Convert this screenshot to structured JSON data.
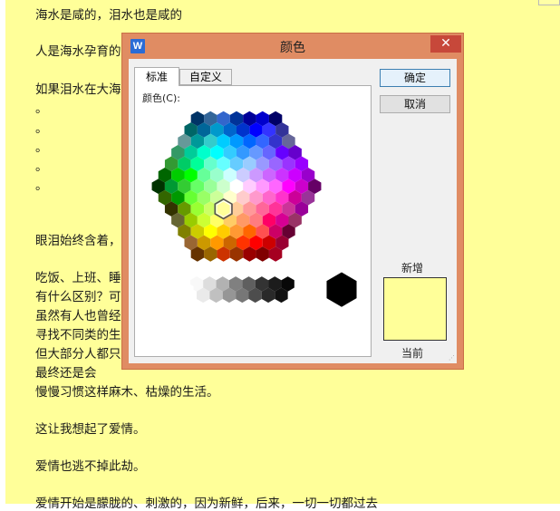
{
  "document": {
    "lines": [
      "海水是咸的，泪水也是咸的",
      "人是海水孕育的",
      "如果泪水在大海里",
      "。",
      "。",
      "。",
      "。",
      "。",
      "眼泪始终含着，",
      "吃饭、上班、睡",
      "有什么区别？可",
      "虽然有人也曾经",
      "寻找不同类的生",
      "但大部分人都只",
      "最终还是会",
      "慢慢习惯这样麻木、枯燥的生活。",
      "这让我想起了爱情。",
      "爱情也逃不掉此劫。",
      "爱情开始是朦胧的、刺激的，因为新鲜，后来，一切一切都过去"
    ]
  },
  "dialog": {
    "app_icon": "W",
    "title": "颜色",
    "close": "✕",
    "tabs": [
      "标准",
      "自定义"
    ],
    "color_label": "颜色(C):",
    "ok": "确定",
    "cancel": "取消",
    "new_label": "新增",
    "current_label": "当前",
    "new_color": "#ffff99",
    "current_color": "#ffff99",
    "selected_color": "#ffff99"
  },
  "palette": {
    "hex_rows": [
      [
        "#003366",
        "#336699",
        "#3366cc",
        "#003399",
        "#000099",
        "#0000cc",
        "#000066"
      ],
      [
        "#006666",
        "#006699",
        "#0099cc",
        "#0066cc",
        "#0033cc",
        "#0000ff",
        "#3333ff",
        "#333399"
      ],
      [
        "#669999",
        "#009999",
        "#33cccc",
        "#00ccff",
        "#0099ff",
        "#0066ff",
        "#3366ff",
        "#3333cc",
        "#666699"
      ],
      [
        "#339966",
        "#00cc99",
        "#00ffcc",
        "#00ffff",
        "#33ccff",
        "#3399ff",
        "#6699ff",
        "#6666ff",
        "#6600ff",
        "#6600cc"
      ],
      [
        "#339933",
        "#00cc66",
        "#00ff99",
        "#66ffcc",
        "#66ffff",
        "#66ccff",
        "#99ccff",
        "#9999ff",
        "#9966ff",
        "#9933ff",
        "#9900ff"
      ],
      [
        "#006600",
        "#00cc00",
        "#00ff00",
        "#66ff99",
        "#99ffcc",
        "#ccffff",
        "#ccccff",
        "#cc99ff",
        "#cc66ff",
        "#cc33ff",
        "#cc00ff",
        "#9900cc"
      ],
      [
        "#003300",
        "#009933",
        "#33cc33",
        "#66ff66",
        "#99ff99",
        "#ccffcc",
        "#ffffff",
        "#ffccff",
        "#ff99ff",
        "#ff66ff",
        "#ff00ff",
        "#cc00cc",
        "#660066"
      ],
      [
        "#336600",
        "#009900",
        "#66ff33",
        "#99ff66",
        "#ccff99",
        "#ffffcc",
        "#ffcccc",
        "#ff99cc",
        "#ff66cc",
        "#ff33cc",
        "#cc0099",
        "#993399"
      ],
      [
        "#333300",
        "#669900",
        "#99ff33",
        "#ccff66",
        "#ffff99",
        "#ffcc99",
        "#ff9999",
        "#ff6699",
        "#ff3399",
        "#cc3399",
        "#990099"
      ],
      [
        "#666633",
        "#99cc00",
        "#ccff33",
        "#ffff66",
        "#ffcc66",
        "#ff9966",
        "#ff7c80",
        "#ff0066",
        "#d60093",
        "#993366"
      ],
      [
        "#808000",
        "#cccc00",
        "#ffff00",
        "#ffcc00",
        "#ff9933",
        "#ff6600",
        "#ff5050",
        "#cc0066",
        "#660033"
      ],
      [
        "#996633",
        "#cc9900",
        "#ff9900",
        "#cc6600",
        "#ff3300",
        "#ff0000",
        "#cc0000",
        "#990033"
      ],
      [
        "#663300",
        "#996600",
        "#cc3300",
        "#993300",
        "#990000",
        "#800000",
        "#a50021"
      ]
    ],
    "gray_top": [
      "#f8f8f8",
      "#dddddd",
      "#b2b2b2",
      "#808080",
      "#5f5f5f",
      "#333333",
      "#1c1c1c",
      "#080808"
    ],
    "gray_bottom": [
      "#eaeaea",
      "#c0c0c0",
      "#969696",
      "#777777",
      "#4d4d4d",
      "#292929",
      "#111111"
    ],
    "white": "#ffffff",
    "black": "#000000"
  }
}
